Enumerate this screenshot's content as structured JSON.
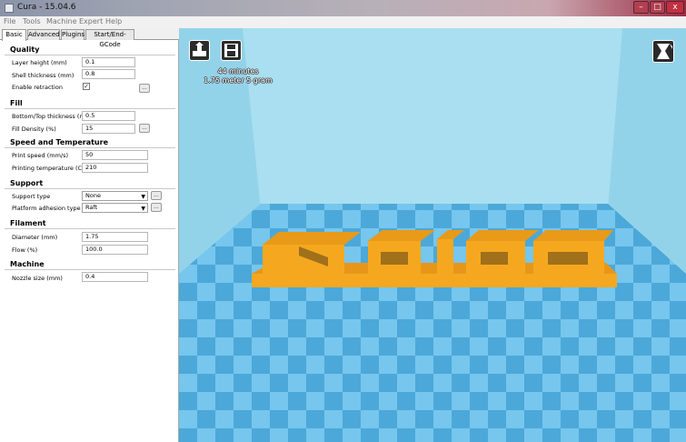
{
  "window": {
    "title": "Cura - 15.04.6",
    "min_glyph": "–",
    "max_glyph": "□",
    "close_glyph": "x"
  },
  "menu": [
    "File",
    "Tools",
    "Machine",
    "Expert",
    "Help"
  ],
  "tabs": [
    "Basic",
    "Advanced",
    "Plugins",
    "Start/End-GCode"
  ],
  "quality": {
    "heading": "Quality",
    "layer_height_label": "Layer height (mm)",
    "layer_height": "0.1",
    "shell_thickness_label": "Shell thickness (mm)",
    "shell_thickness": "0.8",
    "retraction_label": "Enable retraction",
    "retraction_check": "✓"
  },
  "fill": {
    "heading": "Fill",
    "bottom_top_label": "Bottom/Top thickness (mm)",
    "bottom_top": "0.5",
    "density_label": "Fill Density (%)",
    "density": "15"
  },
  "speed": {
    "heading": "Speed and Temperature",
    "print_speed_label": "Print speed (mm/s)",
    "print_speed": "50",
    "temp_label": "Printing temperature (C)",
    "temp": "210"
  },
  "support": {
    "heading": "Support",
    "type_label": "Support type",
    "type": "None",
    "adhesion_label": "Platform adhesion type",
    "adhesion": "Raft"
  },
  "filament": {
    "heading": "Filament",
    "diameter_label": "Diameter (mm)",
    "diameter": "1.75",
    "flow_label": "Flow (%)",
    "flow": "100.0"
  },
  "machine": {
    "heading": "Machine",
    "nozzle_label": "Nozzle size (mm)",
    "nozzle": "0.4"
  },
  "dots_label": "...",
  "dropdown_arrow": "▼",
  "viewer": {
    "time": "44 minutes",
    "material": "1.75 meter 5 gram",
    "load_icon": "load-model-icon",
    "save_icon": "save-toolpath-icon",
    "view_icon": "view-mode-icon"
  },
  "colors": {
    "floor_light": "#76c6ee",
    "floor_dark": "#4ca8d8",
    "wall": "#a9dff0",
    "model": "#f5a81f",
    "model_shadow": "#a0701a"
  }
}
